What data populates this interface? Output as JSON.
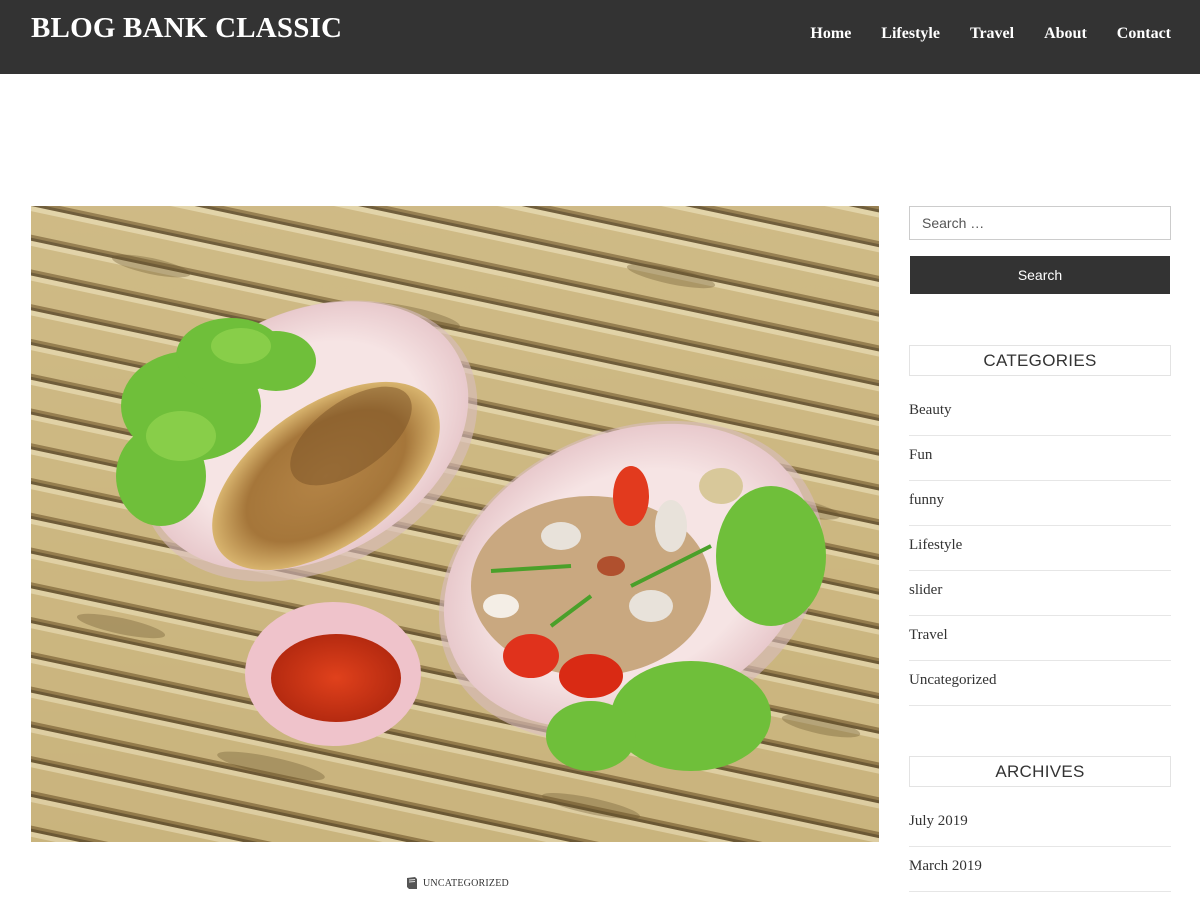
{
  "site": {
    "title": "BLOG BANK CLASSIC"
  },
  "nav": {
    "items": [
      "Home",
      "Lifestyle",
      "Travel",
      "About",
      "Contact"
    ]
  },
  "featured_image": {
    "alt": ""
  },
  "post_meta": {
    "category": "UNCATEGORIZED",
    "icon": "book-icon"
  },
  "search": {
    "placeholder": "Search …",
    "button_label": "Search"
  },
  "categories": {
    "title": "CATEGORIES",
    "items": [
      "Beauty",
      "Fun",
      "funny",
      "Lifestyle",
      "slider",
      "Travel",
      "Uncategorized"
    ]
  },
  "archives": {
    "title": "ARCHIVES",
    "items": [
      "July 2019",
      "March 2019"
    ]
  },
  "colors": {
    "header_bg": "#333333",
    "button_bg": "#333333",
    "text": "#333333"
  }
}
